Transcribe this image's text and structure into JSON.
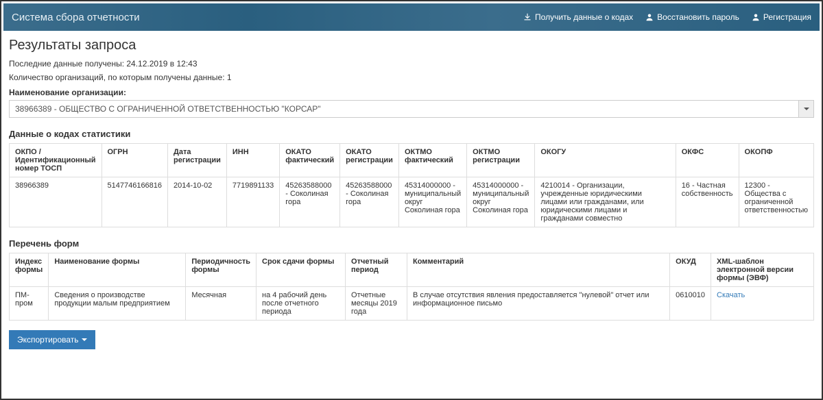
{
  "navbar": {
    "title": "Система сбора отчетности",
    "links": {
      "codes": "Получить данные о кодах",
      "restore": "Восстановить пароль",
      "register": "Регистрация"
    }
  },
  "page_title": "Результаты запроса",
  "meta": {
    "last_received": "Последние данные получены: 24.12.2019 в 12:43",
    "org_count": "Количество организаций, по которым получены данные: 1"
  },
  "org_label": "Наименование организации:",
  "org_selected": "38966389 - ОБЩЕСТВО С ОГРАНИЧЕННОЙ ОТВЕТСТВЕННОСТЬЮ \"КОРСАР\"",
  "stats_section_title": "Данные о кодах статистики",
  "stats_headers": {
    "okpo": "ОКПО / Идентификационный номер ТОСП",
    "ogrn": "ОГРН",
    "reg_date": "Дата регистрации",
    "inn": "ИНН",
    "okato_fact": "ОКАТО фактический",
    "okato_reg": "ОКАТО регистрации",
    "oktmo_fact": "ОКТМО фактический",
    "oktmo_reg": "ОКТМО регистрации",
    "okogu": "ОКОГУ",
    "okfs": "ОКФС",
    "okopf": "ОКОПФ"
  },
  "stats_row": {
    "okpo": "38966389",
    "ogrn": "5147746166816",
    "reg_date": "2014-10-02",
    "inn": "7719891133",
    "okato_fact": "45263588000 - Соколиная гора",
    "okato_reg": "45263588000 - Соколиная гора",
    "oktmo_fact": "45314000000 - муниципальный округ Соколиная гора",
    "oktmo_reg": "45314000000 - муниципальный округ Соколиная гора",
    "okogu": "4210014 - Организации, учрежденные юридическими лицами или гражданами, или юридическими лицами и гражданами совместно",
    "okfs": "16 - Частная собственность",
    "okopf": "12300 - Общества с ограниченной ответственностью"
  },
  "forms_section_title": "Перечень форм",
  "forms_headers": {
    "index": "Индекс формы",
    "name": "Наименование формы",
    "period": "Периодичность формы",
    "deadline": "Срок сдачи формы",
    "rep_period": "Отчетный период",
    "comment": "Комментарий",
    "okud": "ОКУД",
    "xml": "XML-шаблон электронной версии формы (ЭВФ)"
  },
  "forms_row": {
    "index": "ПМ-пром",
    "name": "Сведения о производстве продукции малым предприятием",
    "period": "Месячная",
    "deadline": "на 4 рабочий день после отчетного периода",
    "rep_period": "Отчетные месяцы 2019 года",
    "comment": "В случае отсутствия явления предоставляется \"нулевой\" отчет или информационное письмо",
    "okud": "0610010",
    "xml": "Скачать"
  },
  "export_btn": "Экспортировать"
}
